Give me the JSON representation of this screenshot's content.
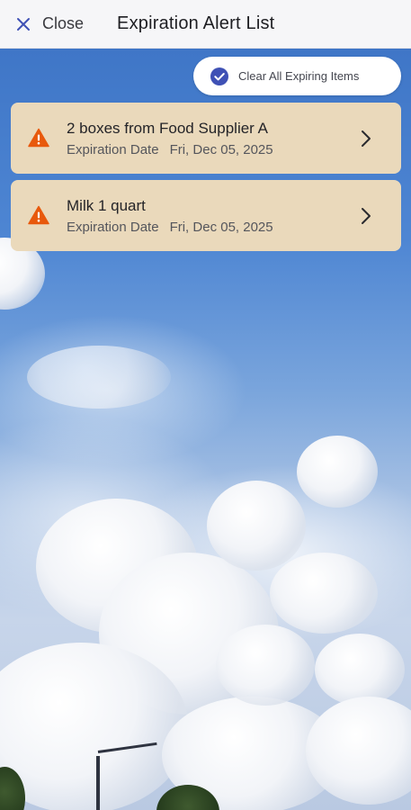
{
  "topbar": {
    "close_label": "Close",
    "title": "Expiration Alert List"
  },
  "actions": {
    "clear_all_label": "Clear All Expiring Items"
  },
  "alerts": [
    {
      "title": "2 boxes from Food Supplier A",
      "date_label": "Expiration Date",
      "date_value": "Fri, Dec 05, 2025"
    },
    {
      "title": "Milk 1 quart",
      "date_label": "Expiration Date",
      "date_value": "Fri, Dec 05, 2025"
    }
  ],
  "icons": {
    "close": "close-icon",
    "check": "check-circle-icon",
    "warning": "warning-icon",
    "chevron": "chevron-right-icon"
  },
  "colors": {
    "accent": "#3f51b5",
    "warning": "#e8590c",
    "card_background": "#ead9bb",
    "topbar_background": "#f6f6f8"
  }
}
